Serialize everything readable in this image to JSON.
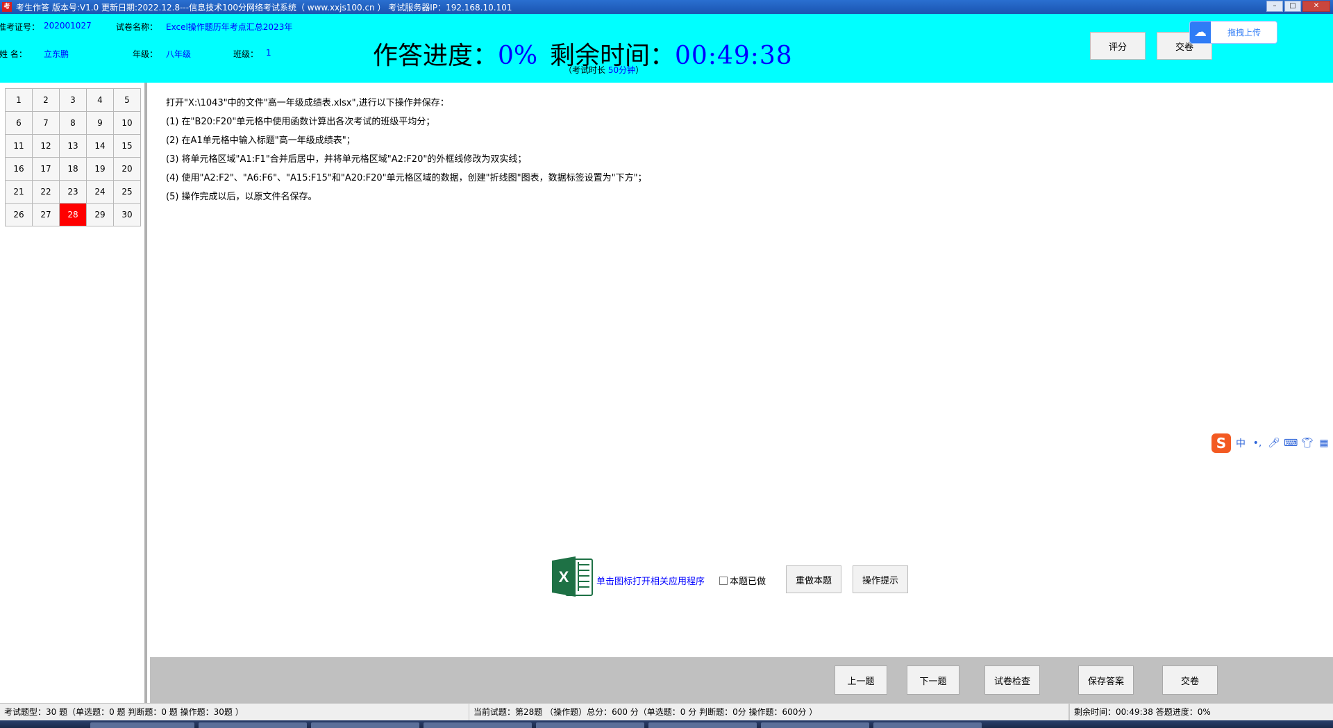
{
  "window": {
    "title": "考生作答 版本号:V1.0 更新日期:2022.12.8---信息技术100分网络考试系统（ www.xxjs100.cn ）   考试服务器IP：192.168.10.101",
    "app_icon": "exam-app-icon",
    "controls": [
      "minimize",
      "maximize",
      "close"
    ]
  },
  "header": {
    "exam_id_label": "准考证号：",
    "exam_id": "202001027",
    "paper_label": "试卷名称：",
    "paper_name": "Excel操作题历年考点汇总2023年",
    "name_label": "姓   名：",
    "name": "立东鹏",
    "grade_label": "年级：",
    "grade": "八年级",
    "class_label": "班级：",
    "class": "1",
    "progress_label": "作答进度：",
    "progress_value": "0%",
    "time_label": "剩余时间：",
    "time_value": "00:49:38",
    "duration_prefix": "（考试时长 ",
    "duration_value": "50分钟",
    "duration_suffix": "）",
    "score_button": "评分",
    "submit_button": "交卷",
    "upload_button": "拖拽上传"
  },
  "question_grid": {
    "numbers": [
      "1",
      "2",
      "3",
      "4",
      "5",
      "6",
      "7",
      "8",
      "9",
      "10",
      "11",
      "12",
      "13",
      "14",
      "15",
      "16",
      "17",
      "18",
      "19",
      "20",
      "21",
      "22",
      "23",
      "24",
      "25",
      "26",
      "27",
      "28",
      "29",
      "30"
    ],
    "current": "28",
    "current_color": "#ff0000"
  },
  "question": {
    "lines": [
      "打开\"X:\\1043\"中的文件\"高一年级成绩表.xlsx\",进行以下操作并保存：",
      "(1)  在\"B20:F20\"单元格中使用函数计算出各次考试的班级平均分；",
      "(2)  在A1单元格中输入标题\"高一年级成绩表\"；",
      "(3)  将单元格区域\"A1:F1\"合并后居中，并将单元格区域\"A2:F20\"的外框线修改为双实线；",
      "(4)  使用\"A2:F2\"、\"A6:F6\"、\"A15:F15\"和\"A20:F20\"单元格区域的数据，创建\"折线图\"图表，数据标签设置为\"下方\"；",
      "(5)  操作完成以后，以原文件名保存。"
    ],
    "open_app_text": "单击图标打开相关应用程序",
    "done_label": "本题已做",
    "redo_button": "重做本题",
    "hint_button": "操作提示"
  },
  "ime": {
    "mode": "中",
    "punct": "•,",
    "icons": [
      "sogou-icon",
      "mic-icon",
      "keyboard-icon",
      "shirt-icon",
      "grid-icon"
    ]
  },
  "nav": {
    "prev": "上一题",
    "next": "下一题",
    "check": "试卷检查",
    "save": "保存答案",
    "submit": "交卷"
  },
  "status": {
    "left": "考试题型：30 题（单选题：0 题 判断题：0 题 操作题：30题 ）",
    "middle": "当前试题：第28题 （操作题）总分：600 分（单选题：0 分 判断题：0分 操作题：600分 ）",
    "right": "剩余时间：00:49:38 答题进度：0%"
  },
  "colors": {
    "header_bg": "#00ffff",
    "value_blue": "#0000ff",
    "bottom_bar": "#c0c0c0",
    "current_question": "#ff0000"
  }
}
